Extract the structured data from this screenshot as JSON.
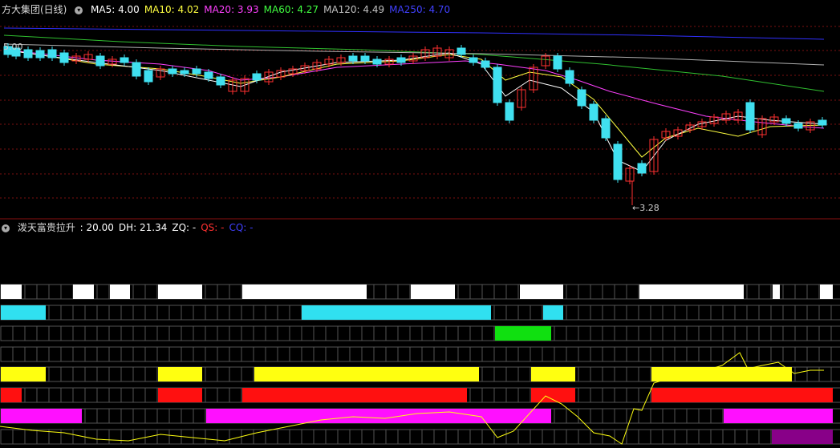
{
  "upper_header": {
    "title": "方大集团(日线)",
    "ma": [
      {
        "label": "MA5: 4.00",
        "color": "#ffffff"
      },
      {
        "label": "MA10: 4.02",
        "color": "#ffff40"
      },
      {
        "label": "MA20: 3.93",
        "color": "#ff40ff"
      },
      {
        "label": "MA60: 4.27",
        "color": "#40ff40"
      },
      {
        "label": "MA120: 4.49",
        "color": "#c0c0c0"
      },
      {
        "label": "MA250: 4.70",
        "color": "#4040ff"
      }
    ]
  },
  "price_label": "5.00",
  "low_label": "3.28",
  "lower_header": {
    "title": "泼天富贵拉升",
    "values": [
      {
        "label": ": 20.00",
        "color": "#ffffff"
      },
      {
        "label": "DH: 21.34",
        "color": "#ffffff"
      },
      {
        "label": "ZQ: -",
        "color": "#ffffff"
      },
      {
        "label": "QS: -",
        "color": "#ff3030"
      },
      {
        "label": "CQ: -",
        "color": "#4040ff"
      }
    ]
  },
  "colors": {
    "up": "#ff3030",
    "down": "#40e0f0",
    "grid": "#7a1010"
  }
}
